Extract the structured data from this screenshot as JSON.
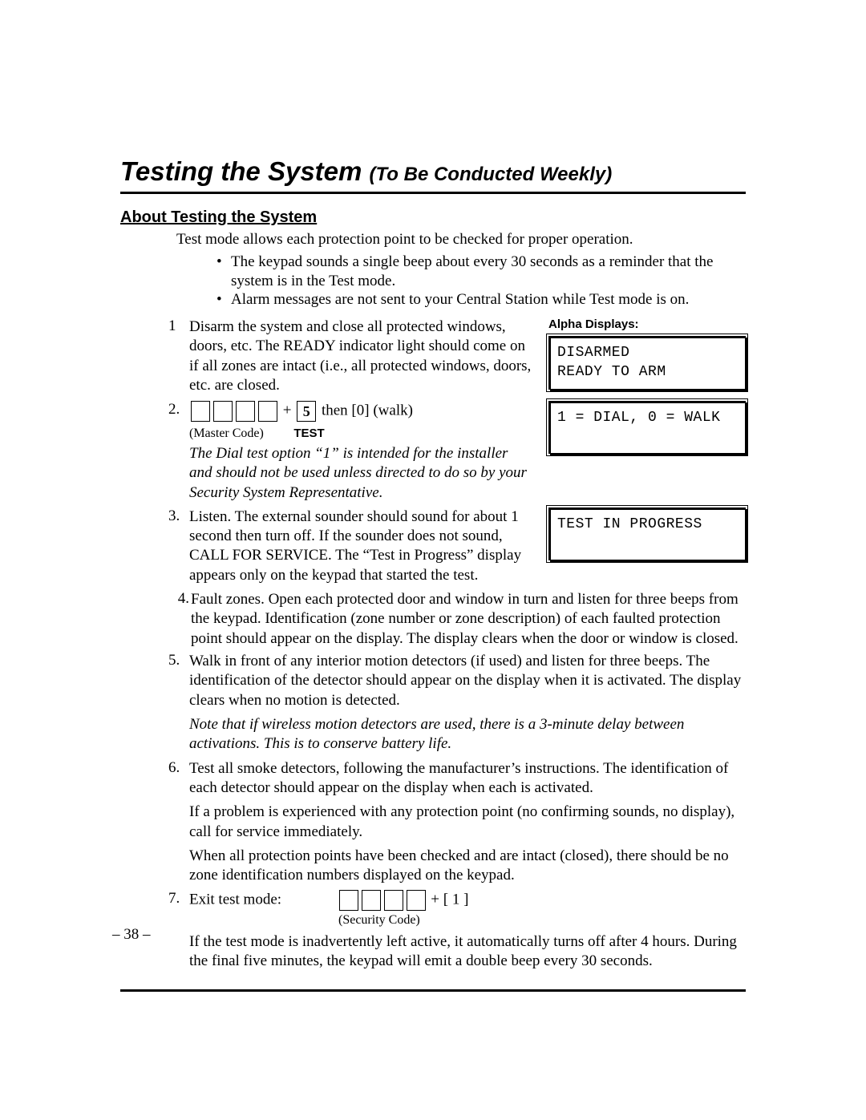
{
  "title_main": "Testing the System ",
  "title_sub": "(To Be Conducted Weekly)",
  "section_head": "About Testing the System",
  "intro": "Test mode allows each protection point to be checked for proper operation.",
  "bullets": [
    "The keypad sounds a single beep about every 30 seconds as a reminder that the system is in the Test mode.",
    "Alarm messages are not sent to your Central Station while Test mode is on."
  ],
  "step1_num": "1",
  "step1_text": "Disarm the system and close all protected windows, doors, etc. The READY indicator light should come on if all zones are intact (i.e., all protected windows, doors, etc. are closed.",
  "alpha_label": "Alpha Displays:",
  "lcd1_line1": "DISARMED",
  "lcd1_line2": "READY TO ARM",
  "step2_num": "2.",
  "step2_key5": "5",
  "step2_after": "   then  [0] (walk)",
  "step2_master": "(Master Code)",
  "step2_test": "TEST",
  "step2_italic": "The Dial test option “1” is intended for the installer and should not be used unless directed to do so by your Security System Representative.",
  "lcd2": "1 = DIAL,  0 = WALK",
  "step3_num": "3.",
  "step3_text": "Listen. The external sounder should sound for about 1 second then turn off. If the sounder does not sound, CALL FOR SERVICE. The “Test in Progress” display appears only on the keypad that started the test.",
  "lcd3": "TEST IN PROGRESS",
  "step4_num": "4.",
  "step4_text": "Fault zones. Open each protected door and window in turn and listen for three beeps from the keypad. Identification (zone number or zone description) of each faulted protection point should appear on the display. The display clears when the door or window is closed.",
  "step5_num": "5.",
  "step5_text": "Walk in front of any interior motion detectors (if used) and listen for three beeps. The identification of the detector should appear on the display when it is activated. The display clears when no motion is detected.",
  "step5_note": "Note that if wireless motion detectors are used, there is a 3-minute delay between activations. This is to conserve battery life.",
  "step6_num": "6.",
  "step6_p1": "Test all smoke detectors, following the manufacturer’s instructions. The identification of each detector should appear on the display when each is activated.",
  "step6_p2": "If a problem is experienced with any protection point (no confirming sounds, no display), call for service immediately.",
  "step6_p3": "When all protection points have been checked and are intact (closed), there should be no zone identification numbers displayed on the keypad.",
  "step7_num": "7.",
  "step7_label": "Exit test mode:",
  "step7_plus": "   +   [ 1 ]",
  "step7_sec": "(Security Code)",
  "step7_tail": "If the test mode is inadvertently left active, it automatically turns off after 4 hours. During the final five minutes, the keypad will emit a double beep every 30 seconds.",
  "page_num": "– 38 –",
  "plus_sign": " + "
}
